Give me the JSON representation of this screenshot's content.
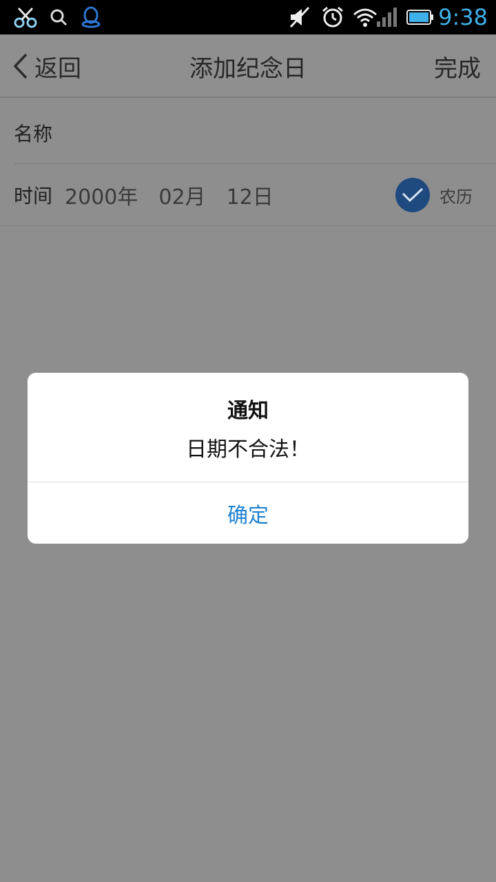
{
  "status_bar": {
    "time": "9:38",
    "icons": [
      "scissors-icon",
      "search-icon",
      "qq-penguin-icon",
      "mute-icon",
      "alarm-icon",
      "wifi-icon",
      "signal-icon",
      "battery-icon"
    ]
  },
  "nav": {
    "back_label": "返回",
    "title": "添加纪念日",
    "done_label": "完成"
  },
  "form": {
    "name_label": "名称",
    "time_label": "时间",
    "year": "2000年",
    "month": "02月",
    "day": "12日",
    "lunar_label": "农历",
    "lunar_checked": true
  },
  "dialog": {
    "title": "通知",
    "message": "日期不合法！",
    "ok_label": "确定"
  },
  "colors": {
    "accent_blue": "#1e82d2",
    "check_blue": "#1f4a7f",
    "time_blue": "#3fb0e8",
    "overlay_gray": "#8e8e8e"
  }
}
